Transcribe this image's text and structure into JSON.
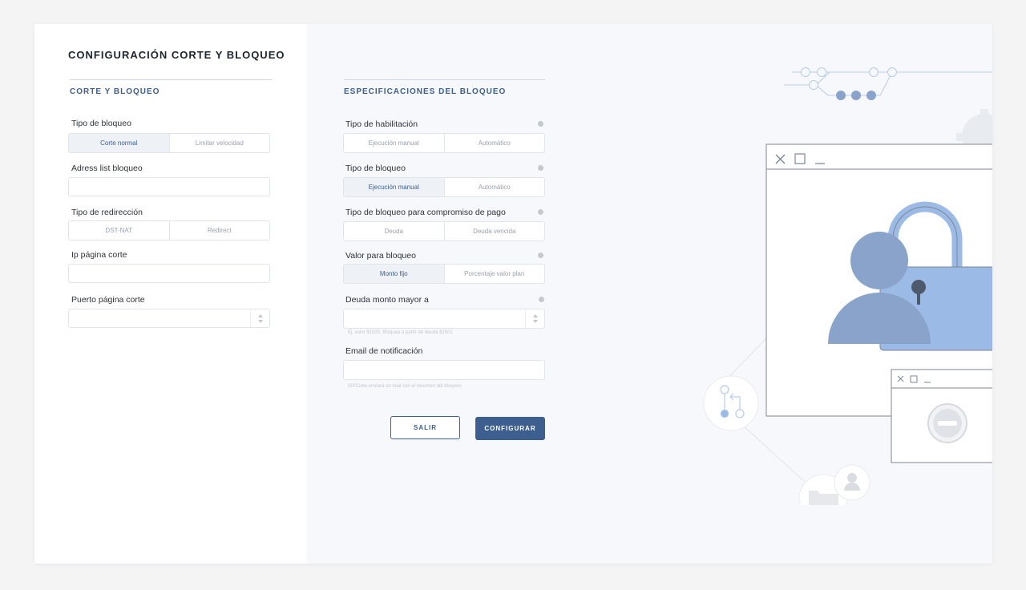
{
  "page_title": "CONFIGURACIÓN CORTE Y BLOQUEO",
  "left_section": {
    "title": "CORTE Y BLOQUEO",
    "tipo_bloqueo": {
      "label": "Tipo de bloqueo",
      "options": [
        "Corte normal",
        "Limitar velocidad"
      ],
      "selected": "Corte normal"
    },
    "adress_list": {
      "label": "Adress list bloqueo",
      "value": ""
    },
    "tipo_redireccion": {
      "label": "Tipo de redirección",
      "options": [
        "DST-NAT",
        "Redirect"
      ],
      "selected": ""
    },
    "ip_pagina": {
      "label": "Ip página corte",
      "value": ""
    },
    "puerto_pagina": {
      "label": "Puerto página corte",
      "value": ""
    }
  },
  "right_section": {
    "title": "ESPECIFICACIONES DEL BLOQUEO",
    "tipo_habilitacion": {
      "label": "Tipo de habilitación",
      "options": [
        "Ejecución manual",
        "Automático"
      ],
      "selected": ""
    },
    "tipo_bloqueo": {
      "label": "Tipo de bloqueo",
      "options": [
        "Ejecución manual",
        "Automático"
      ],
      "selected": "Ejecución manual"
    },
    "tipo_bloqueo_pago": {
      "label": "Tipo de bloqueo para compromiso de pago",
      "options": [
        "Deuda",
        "Deuda vencida"
      ],
      "selected": ""
    },
    "valor_bloqueo": {
      "label": "Valor para bloqueo",
      "options": [
        "Monto fijo",
        "Porcentaje valor plan"
      ],
      "selected": "Monto fijo"
    },
    "deuda_monto": {
      "label": "Deuda monto mayor a",
      "value": "",
      "hint": "Ej. valor $1500. Bloquea a partir de deuda $1501"
    },
    "email": {
      "label": "Email de notificación",
      "value": "",
      "hint": "ISPCube enviará un mail con el resumen del bloqueo"
    }
  },
  "buttons": {
    "exit": "SALIR",
    "configure": "CONFIGURAR"
  },
  "colors": {
    "accent": "#3c5f8f",
    "illustration": "#8aa3cb",
    "illustration_light": "#9bbbe6",
    "panel_bg": "#f6f8fc"
  },
  "icons": [
    "info-icon",
    "spin-up-icon",
    "spin-down-icon",
    "close-icon",
    "maximize-icon",
    "minimize-icon",
    "user-icon",
    "padlock-icon",
    "folder-icon",
    "git-branch-icon",
    "blocked-icon",
    "gear-icon"
  ]
}
